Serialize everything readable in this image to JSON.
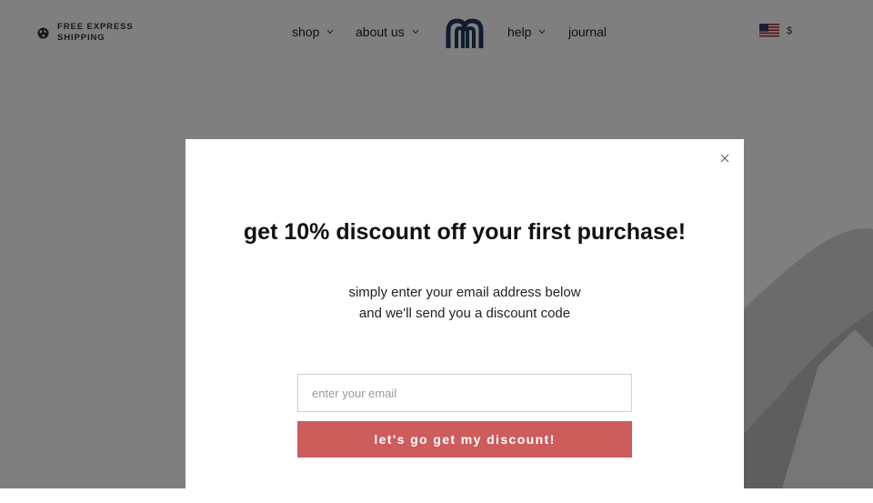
{
  "header": {
    "shipping_line1": "FREE EXPRESS",
    "shipping_line2": "SHIPPING",
    "nav": {
      "shop": "shop",
      "about": "about us",
      "help": "help",
      "journal": "journal"
    },
    "currency": "$"
  },
  "popup": {
    "headline": "get 10% discount off your first purchase!",
    "subtext": "simply enter your email address below and we'll send you a discount code",
    "email_placeholder": "enter your email",
    "email_value": "",
    "cta_label": "let's go get my discount!"
  },
  "colors": {
    "cta": "#cd5c5c",
    "overlay": "rgba(0,0,0,0.50)",
    "modal_bg": "#ffffff"
  },
  "icons": [
    "globe-icon",
    "chevron-down-icon",
    "brand-logo",
    "us-flag-icon",
    "close-icon"
  ]
}
